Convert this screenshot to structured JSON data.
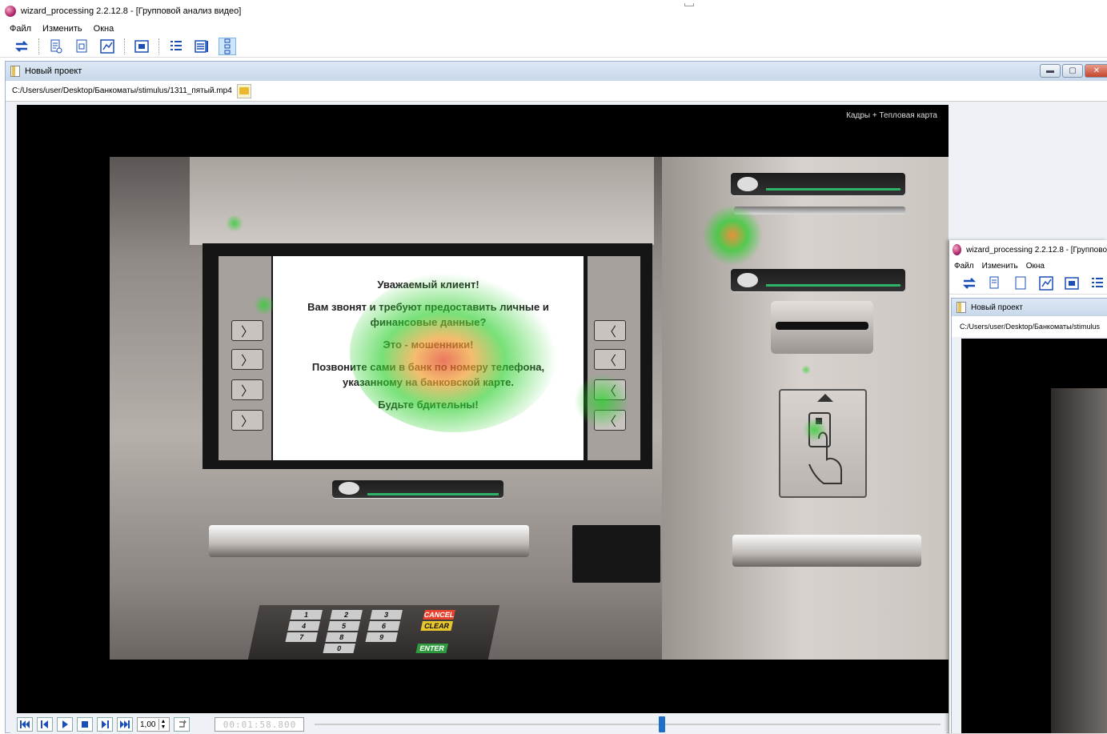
{
  "window": {
    "title": "wizard_processing 2.2.12.8 - [Групповой анализ видео]"
  },
  "menu": [
    "Файл",
    "Изменить",
    "Окна"
  ],
  "toolbar": {
    "icons": [
      "swap-icon",
      "report-icon",
      "document-icon",
      "graph-icon",
      "frame-icon",
      "list-icon",
      "rows-icon",
      "dots-icon"
    ],
    "active": "dots-icon"
  },
  "child": {
    "title": "Новый проект",
    "path": "C:/Users/user/Desktop/Банкоматы/stimulus/1311_пятый.mp4",
    "mode_label": "Кадры + Тепловая карта",
    "atm_screen": {
      "line1": "Уважаемый клиент!",
      "line2": "Вам звонят и требуют предоставить личные и финансовые данные?",
      "line3": "Это - мошенники!",
      "line4": "Позвоните сами в банк по номеру телефона, указанному на банковской карте.",
      "line5": "Будьте бдительны!"
    },
    "keypad": {
      "keys": [
        "1",
        "2",
        "3",
        "4",
        "5",
        "6",
        "7",
        "8",
        "9",
        "0"
      ],
      "cancel": "CANCEL",
      "clear": "CLEAR",
      "enter": "ENTER"
    }
  },
  "playback": {
    "speed": "1,00",
    "timecode": "00:01:58.800",
    "position": 0.55
  },
  "overlay": {
    "title": "wizard_processing 2.2.12.8 - [Группово",
    "menu": [
      "Файл",
      "Изменить",
      "Окна"
    ],
    "child_title": "Новый проект",
    "path": "C:/Users/user/Desktop/Банкоматы/stimulus"
  },
  "colors": {
    "accent": "#1a4fb8",
    "heat_green": "#2fd02f",
    "heat_orange": "#f0a030",
    "heat_red": "#e44a2a"
  }
}
